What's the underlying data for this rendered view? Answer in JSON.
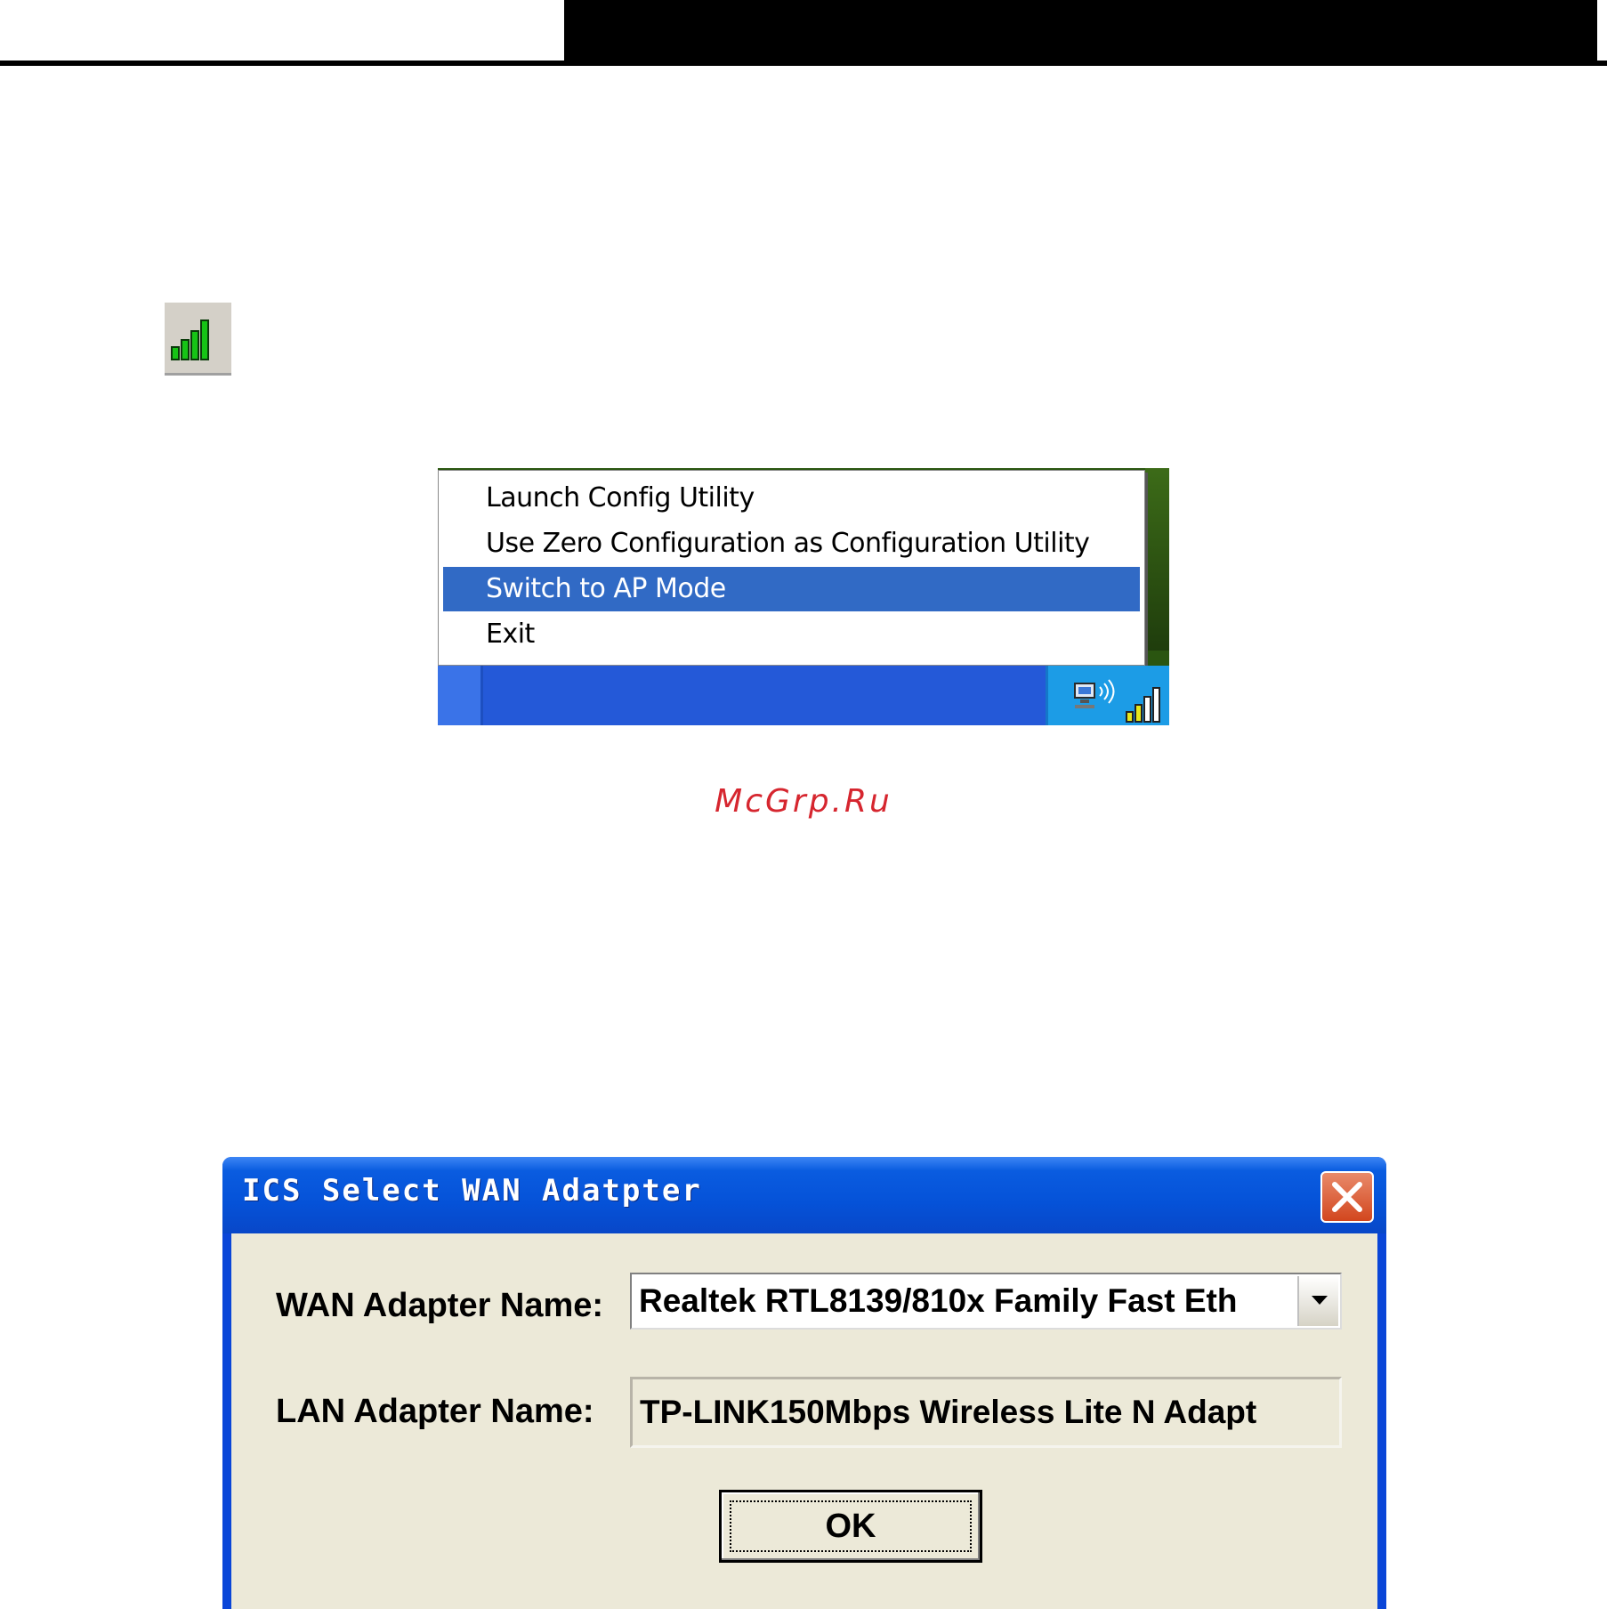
{
  "tray_icon": {
    "icon": "signal-strength-icon"
  },
  "context_menu": {
    "items": [
      {
        "label": "Launch Config Utility",
        "selected": false
      },
      {
        "label": "Use Zero Configuration as Configuration Utility",
        "selected": false
      },
      {
        "label": "Switch to AP Mode",
        "selected": true
      },
      {
        "label": "Exit",
        "selected": false
      }
    ],
    "selection_color": "#316ac5"
  },
  "taskbar": {
    "color": "#2459d8",
    "tray_color": "#1c9ce6"
  },
  "watermark": {
    "text": "McGrp.Ru",
    "color": "#d6262f"
  },
  "dialog": {
    "title": "ICS Select WAN Adatpter",
    "wan_label": "WAN Adapter Name:",
    "wan_value": "Realtek RTL8139/810x Family Fast Eth",
    "lan_label": "LAN Adapter Name:",
    "lan_value": "TP-LINK150Mbps Wireless Lite N Adapt",
    "ok_label": "OK",
    "title_color": "#0552d8"
  }
}
